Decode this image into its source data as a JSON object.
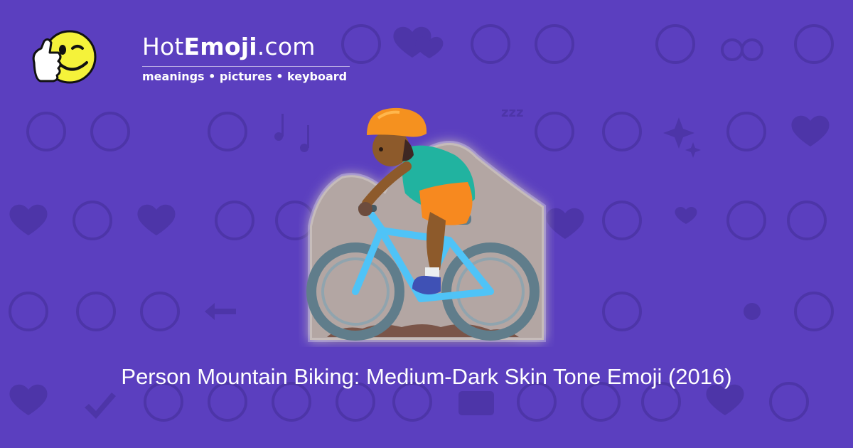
{
  "brand": {
    "name_prefix": "Hot",
    "name_bold": "Emoji",
    "name_suffix": ".com",
    "tagline": "meanings • pictures • keyboard"
  },
  "caption": "Person Mountain Biking: Medium-Dark Skin Tone Emoji (2016)",
  "colors": {
    "background": "#5b3fbf",
    "pattern": "#4d35a8",
    "text": "#ffffff",
    "mascot_face": "#f5f23a",
    "helmet": "#f5911f",
    "shirt": "#21b3a0",
    "shorts": "#f7891f",
    "bike_frame": "#4fc3f7",
    "tires": "#607d8b",
    "rock": "#b3a6a3"
  },
  "icons": [
    "thumbs-up-smiley-logo",
    "person-mountain-biking-emoji",
    "emoji-pattern-background"
  ]
}
